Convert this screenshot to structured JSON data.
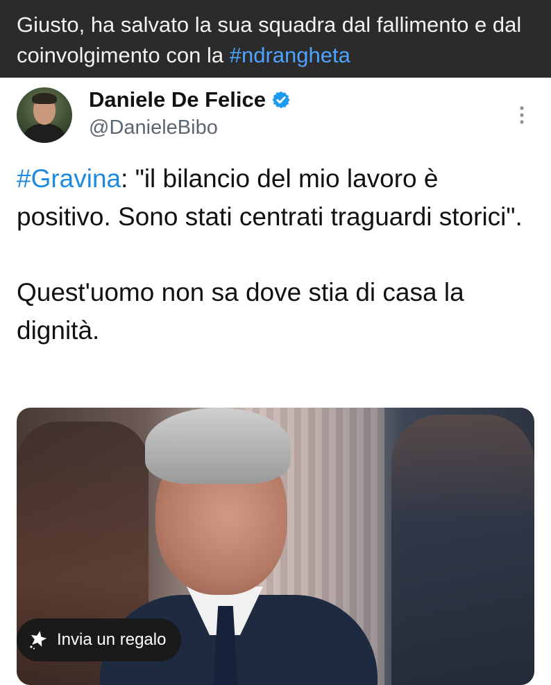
{
  "caption": {
    "text_before": "Giusto, ha salvato la sua squadra dal fallimento e dal coinvolgimento con la ",
    "hashtag": "#ndrangheta"
  },
  "tweet": {
    "display_name": "Daniele De Felice",
    "handle": "@DanieleBibo",
    "text_hashtag": "#Gravina",
    "text_line1_rest": ": \"il bilancio del mio lavoro è positivo. Sono stati centrati traguardi storici\".",
    "text_para2": "Quest'uomo non sa dove stia di casa la dignità."
  },
  "gift_button": {
    "label": "Invia un regalo"
  },
  "colors": {
    "caption_bg": "#2b2b2b",
    "hashtag_link": "#1d8ae0",
    "verified_badge": "#1d9bf0"
  },
  "icons": {
    "verified": "verified-badge-icon",
    "more": "more-vertical-icon",
    "gift": "gift-star-icon"
  }
}
